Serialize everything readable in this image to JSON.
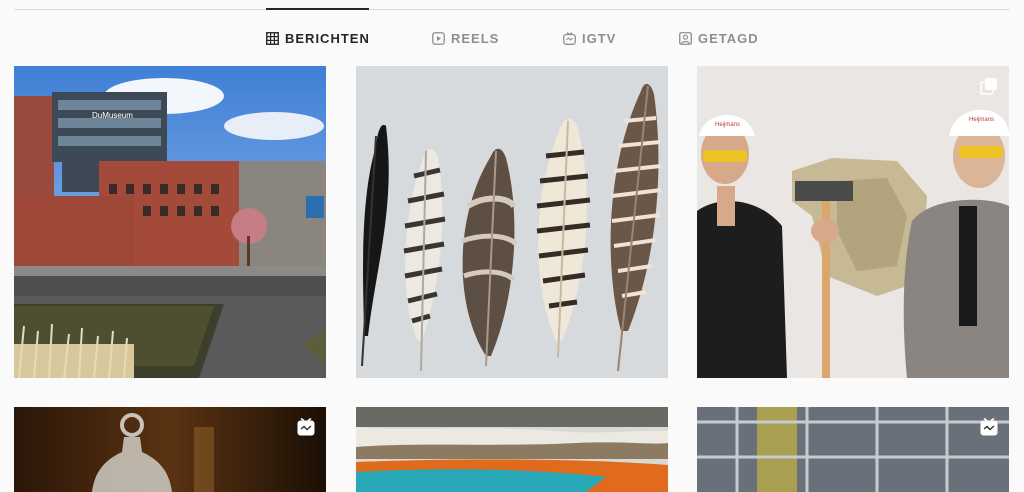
{
  "tabs": [
    {
      "label": "BERICHTEN",
      "icon": "grid-icon",
      "active": true
    },
    {
      "label": "REELS",
      "icon": "reels-icon",
      "active": false
    },
    {
      "label": "IGTV",
      "icon": "igtv-icon",
      "active": false
    },
    {
      "label": "GETAGD",
      "icon": "tagged-icon",
      "active": false
    }
  ],
  "posts": [
    {
      "subject": "modern-building-with-reflecting-pool",
      "badge": null
    },
    {
      "subject": "five-feathers",
      "badge": null
    },
    {
      "subject": "two-men-with-sledgehammer",
      "badge": "carousel-icon"
    },
    {
      "subject": "glass-bell",
      "badge": "reel-icon"
    },
    {
      "subject": "colorful-hot-spring",
      "badge": null
    },
    {
      "subject": "metal-fence",
      "badge": "reel-icon"
    }
  ],
  "photo_texts": {
    "building_sign": "DuMuseum",
    "helmet_brand_left": "Heijmans",
    "helmet_brand_right": "Heijmans"
  },
  "colors": {
    "background": "#fafafa",
    "active_tab": "#262626",
    "inactive_tab": "#8e8e8e",
    "divider": "#dbdbdb"
  }
}
